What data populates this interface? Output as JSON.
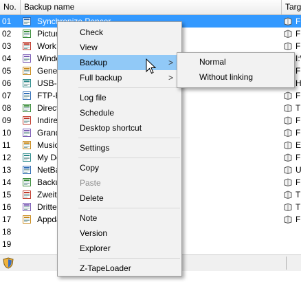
{
  "header": {
    "col_no": "No.",
    "col_name": "Backup name",
    "col_target": "Targ"
  },
  "rows": [
    {
      "no": "01",
      "name": "Synchronize Pencer",
      "tgt": "F"
    },
    {
      "no": "02",
      "name": "Pictur",
      "tgt": "F"
    },
    {
      "no": "03",
      "name": "Work",
      "tgt": "F"
    },
    {
      "no": "04",
      "name": "Windo",
      "tgt": "I:\\"
    },
    {
      "no": "05",
      "name": "Gene",
      "tgt": "F"
    },
    {
      "no": "06",
      "name": "USB-I",
      "tgt": "H"
    },
    {
      "no": "07",
      "name": "FTP-E",
      "tgt": "F"
    },
    {
      "no": "08",
      "name": "Direct",
      "tgt": "T"
    },
    {
      "no": "09",
      "name": "Indire",
      "tgt": "F"
    },
    {
      "no": "10",
      "name": "Grand",
      "tgt": "F"
    },
    {
      "no": "11",
      "name": "Music",
      "tgt": "E"
    },
    {
      "no": "12",
      "name": "My Do",
      "tgt": "F"
    },
    {
      "no": "13",
      "name": "NetBa",
      "tgt": "U"
    },
    {
      "no": "14",
      "name": "Backu",
      "tgt": "F"
    },
    {
      "no": "15",
      "name": "Zweite",
      "tgt": "T"
    },
    {
      "no": "16",
      "name": "Dritte",
      "tgt": "T"
    },
    {
      "no": "17",
      "name": "Appda",
      "tgt": "F"
    },
    {
      "no": "18",
      "name": "",
      "tgt": ""
    },
    {
      "no": "19",
      "name": "",
      "tgt": ""
    }
  ],
  "context_menu": {
    "check": "Check",
    "view": "View",
    "backup": "Backup",
    "full_backup": "Full backup",
    "log_file": "Log file",
    "schedule": "Schedule",
    "desktop_shortcut": "Desktop shortcut",
    "settings": "Settings",
    "copy": "Copy",
    "paste": "Paste",
    "delete": "Delete",
    "note": "Note",
    "version": "Version",
    "explorer": "Explorer",
    "tapeloader": "Z-TapeLoader",
    "submenu_arrow": ">"
  },
  "submenu": {
    "normal": "Normal",
    "without_linking": "Without linking"
  },
  "colors": {
    "selection": "#3399ff",
    "menu_highlight": "#91c9f7",
    "menu_bg": "#f2f2f2"
  }
}
